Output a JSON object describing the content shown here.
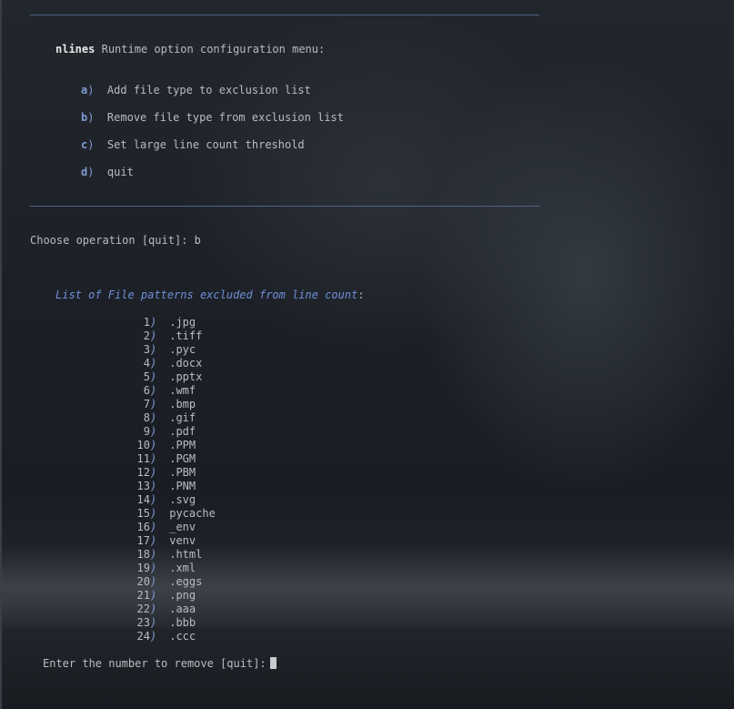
{
  "header": {
    "app_name": "nlines",
    "menu_title": "Runtime option configuration menu:"
  },
  "menu": {
    "items": [
      {
        "key": "a",
        "label": "Add file type to exclusion list"
      },
      {
        "key": "b",
        "label": "Remove file type from exclusion list"
      },
      {
        "key": "c",
        "label": "Set large line count threshold"
      },
      {
        "key": "d",
        "label": "quit"
      }
    ]
  },
  "prompt": {
    "choose_label": "Choose operation [quit]:",
    "choose_value": "b"
  },
  "exclusions": {
    "title": "List of File patterns excluded from line count",
    "items": [
      {
        "num": "1",
        "pattern": ".jpg"
      },
      {
        "num": "2",
        "pattern": ".tiff"
      },
      {
        "num": "3",
        "pattern": ".pyc"
      },
      {
        "num": "4",
        "pattern": ".docx"
      },
      {
        "num": "5",
        "pattern": ".pptx"
      },
      {
        "num": "6",
        "pattern": ".wmf"
      },
      {
        "num": "7",
        "pattern": ".bmp"
      },
      {
        "num": "8",
        "pattern": ".gif"
      },
      {
        "num": "9",
        "pattern": ".pdf"
      },
      {
        "num": "10",
        "pattern": ".PPM"
      },
      {
        "num": "11",
        "pattern": ".PGM"
      },
      {
        "num": "12",
        "pattern": ".PBM"
      },
      {
        "num": "13",
        "pattern": ".PNM"
      },
      {
        "num": "14",
        "pattern": ".svg"
      },
      {
        "num": "15",
        "pattern": "pycache"
      },
      {
        "num": "16",
        "pattern": "_env"
      },
      {
        "num": "17",
        "pattern": "venv"
      },
      {
        "num": "18",
        "pattern": ".html"
      },
      {
        "num": "19",
        "pattern": ".xml"
      },
      {
        "num": "20",
        "pattern": ".eggs"
      },
      {
        "num": "21",
        "pattern": ".png"
      },
      {
        "num": "22",
        "pattern": ".aaa"
      },
      {
        "num": "23",
        "pattern": ".bbb"
      },
      {
        "num": "24",
        "pattern": ".ccc"
      }
    ]
  },
  "remove_prompt": {
    "label": "Enter the number to remove [quit]:"
  }
}
